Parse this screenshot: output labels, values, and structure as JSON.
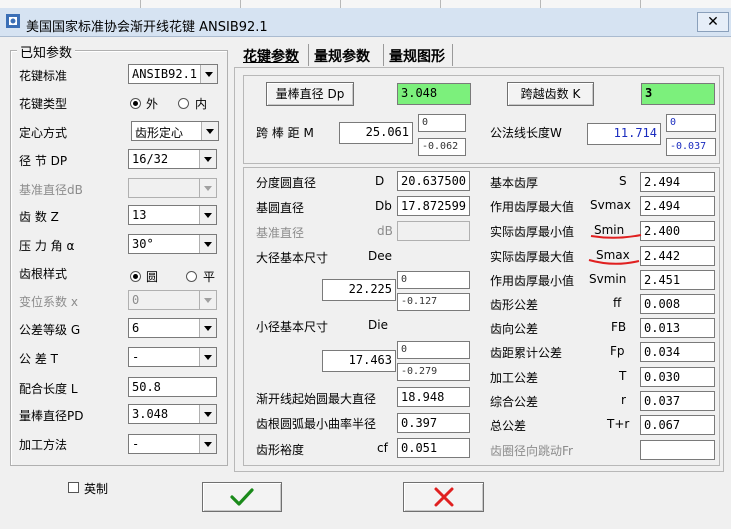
{
  "window": {
    "title": "美国国家标准协会渐开线花键 ANSIB92.1",
    "close_glyph": "✕"
  },
  "known": {
    "legend": "已知参数",
    "spline_std_label": "花键标准",
    "spline_std_value": "ANSIB92.1",
    "spline_type_label": "花键类型",
    "spline_type_outer": "外",
    "spline_type_inner": "内",
    "centering_label": "定心方式",
    "centering_value": "齿形定心",
    "dp_label": "径 节 DP",
    "dp_value": "16/32",
    "ref_dia_label": "基准直径dB",
    "ref_dia_value": "",
    "teeth_label": "齿 数 Z",
    "teeth_value": "13",
    "pressure_label": "压 力 角 α",
    "pressure_value": "30°",
    "root_label": "齿根样式",
    "root_round": "圆",
    "root_flat": "平",
    "shift_label": "变位系数 x",
    "shift_value": "0",
    "grade_label": "公差等级 G",
    "grade_value": "6",
    "tol_label": "公 差 T",
    "tol_value": "-",
    "length_label": "配合长度 L",
    "length_value": "50.8",
    "pd_label": "量棒直径PD",
    "pd_value": "3.048",
    "method_label": "加工方法",
    "method_value": "-",
    "imperial_label": "英制"
  },
  "tabs": [
    "花键参数",
    "量规参数",
    "量规图形"
  ],
  "measure": {
    "dp_btn": "量棒直径 Dp",
    "dp_value": "3.048",
    "k_btn": "跨越齿数 K",
    "k_value": "3",
    "m_label": "跨 棒 距 M",
    "m_value": "25.061",
    "m_upper": "0",
    "m_lower": "-0.062",
    "w_label": "公法线长度W",
    "w_value": "11.714",
    "w_upper": "0",
    "w_lower": "-0.037"
  },
  "left": {
    "pitch_label": "分度圆直径",
    "pitch_sym": "D",
    "pitch_value": "20.637500",
    "base_label": "基圆直径",
    "base_sym": "Db",
    "base_value": "17.872599",
    "ref_label": "基准直径",
    "ref_sym": "dB",
    "ref_value": "",
    "major_label": "大径基本尺寸",
    "major_sym": "Dee",
    "major_value": "22.225",
    "major_upper": "0",
    "major_lower": "-0.127",
    "minor_label": "小径基本尺寸",
    "minor_sym": "Die",
    "minor_value": "17.463",
    "minor_upper": "0",
    "minor_lower": "-0.279",
    "form_label": "渐开线起始圆最大直径",
    "form_value": "18.948",
    "fillet_label": "齿根圆弧最小曲率半径",
    "fillet_value": "0.397",
    "clear_label": "齿形裕度",
    "clear_sym": "cf",
    "clear_value": "0.051"
  },
  "right": {
    "rows": [
      {
        "label": "基本齿厚",
        "sym": "S",
        "value": "2.494"
      },
      {
        "label": "作用齿厚最大值",
        "sym": "Svmax",
        "value": "2.494"
      },
      {
        "label": "实际齿厚最小值",
        "sym": "Smin",
        "value": "2.400"
      },
      {
        "label": "实际齿厚最大值",
        "sym": "Smax",
        "value": "2.442"
      },
      {
        "label": "作用齿厚最小值",
        "sym": "Svmin",
        "value": "2.451"
      },
      {
        "label": "齿形公差",
        "sym": "ff",
        "value": "0.008"
      },
      {
        "label": "齿向公差",
        "sym": "FB",
        "value": "0.013"
      },
      {
        "label": "齿距累计公差",
        "sym": "Fp",
        "value": "0.034"
      },
      {
        "label": "加工公差",
        "sym": "T",
        "value": "0.030"
      },
      {
        "label": "综合公差",
        "sym": "r",
        "value": "0.037"
      },
      {
        "label": "总公差",
        "sym": "T+r",
        "value": "0.067"
      }
    ],
    "runout_label": "齿圈径向跳动Fr",
    "runout_value": ""
  },
  "colors": {
    "green": "#7cf07c",
    "annotation_red": "#e02020",
    "ok_green": "#1a8a1a",
    "cancel_red": "#e02020"
  }
}
